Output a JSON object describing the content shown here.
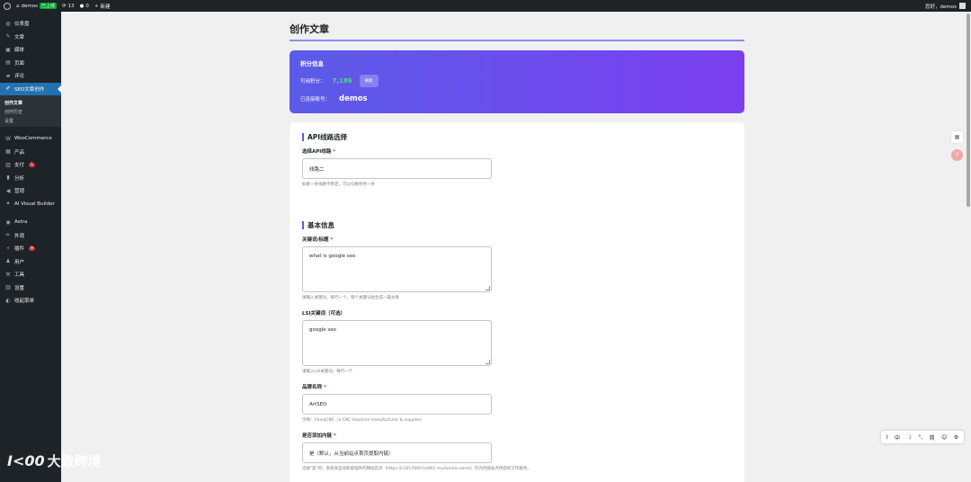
{
  "adminbar": {
    "site_name": "demos",
    "live_badge": "已上线",
    "comments_count": "13",
    "pending_count": "0",
    "new_label": "新建",
    "greeting": "您好，demos"
  },
  "sidebar": {
    "items_top": [
      {
        "icon": "dashboard-icon",
        "glyph": "◍",
        "label": "仪表盘"
      },
      {
        "icon": "pin-icon",
        "glyph": "✎",
        "label": "文章"
      },
      {
        "icon": "media-icon",
        "glyph": "▣",
        "label": "媒体"
      },
      {
        "icon": "page-icon",
        "glyph": "▤",
        "label": "页面"
      },
      {
        "icon": "comment-icon",
        "glyph": "▰",
        "label": "评论"
      }
    ],
    "active_item": {
      "icon": "pen-icon",
      "glyph": "✐",
      "label": "SEO文章创作"
    },
    "submenu": [
      "创作文章",
      "创作历史",
      "设置"
    ],
    "items_mid": [
      {
        "icon": "woocommerce-icon",
        "glyph": "W",
        "label": "WooCommerce"
      },
      {
        "icon": "products-icon",
        "glyph": "▦",
        "label": "产品"
      },
      {
        "icon": "payments-icon",
        "glyph": "▥",
        "label": "支付",
        "badge": "1"
      },
      {
        "icon": "analytics-icon",
        "glyph": "▮",
        "label": "分析"
      },
      {
        "icon": "marketing-icon",
        "glyph": "◀",
        "label": "营销"
      },
      {
        "icon": "ai-builder-icon",
        "glyph": "✦",
        "label": "AI Visual Builder"
      }
    ],
    "items_bottom": [
      {
        "icon": "astra-icon",
        "glyph": "◉",
        "label": "Astra"
      },
      {
        "icon": "appearance-icon",
        "glyph": "✏",
        "label": "外观"
      },
      {
        "icon": "plugins-icon",
        "glyph": "⚡",
        "label": "插件",
        "badge": "9"
      },
      {
        "icon": "users-icon",
        "glyph": "♟",
        "label": "用户"
      },
      {
        "icon": "tools-icon",
        "glyph": "⚒",
        "label": "工具"
      },
      {
        "icon": "settings-icon",
        "glyph": "▥",
        "label": "设置"
      },
      {
        "icon": "collapse-icon",
        "glyph": "◐",
        "label": "收起菜单"
      }
    ]
  },
  "main": {
    "page_title": "创作文章",
    "points_card": {
      "title": "积分信息",
      "available_label": "可用积分：",
      "available_value": "7,186",
      "refresh_label": "刷新",
      "bound_label": "已连接账号：",
      "bound_value": "demos"
    },
    "api_section": {
      "title": "API线路选择",
      "label": "选择API线路",
      "value": "线路二",
      "hint": "如果一条线路不稳定，可以切换到另一条"
    },
    "basic_section": {
      "title": "基本信息",
      "keyword_label": "关键词/标题",
      "keyword_value": "what is google seo",
      "keyword_hint": "请输入关键词，每行一个，每个关键词会生成一篇文章",
      "lsi_label": "LSI关键词（可选）",
      "lsi_value": "google seo",
      "lsi_hint": "请输入LSI关键词，每行一个",
      "brand_label": "品牌名称",
      "brand_value": "ArtSEO",
      "brand_hint": "示例：ChinaCNC（a CNC machine manufacturer & supplier）",
      "link_label": "是否添加内链",
      "link_value": "是（默认，从当前站点首页提取内链）",
      "link_hint": "选择\"是\"时，系统会自动抓取插件的网站首页（https://c1017600.ha001.mydomain.zone/）作为内链站点供后续写作服务。"
    }
  },
  "ime_bar": [
    "I",
    "中",
    "☽",
    "°,",
    "简",
    "☺",
    "⚙"
  ],
  "watermark": {
    "logo": "I<00",
    "text": "大数跨境"
  }
}
